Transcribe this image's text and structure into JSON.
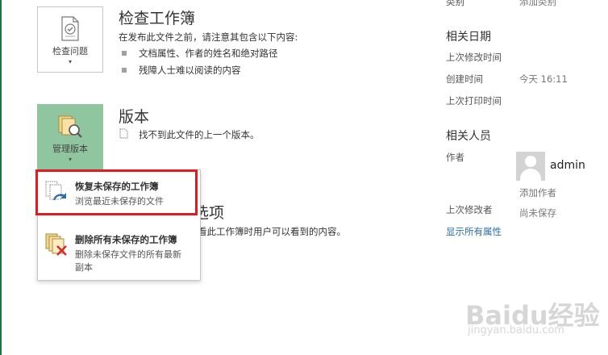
{
  "inspect": {
    "button_label": "检查问题",
    "title": "检查工作簿",
    "desc": "在发布此文件之前，请注意其包含以下内容:",
    "bullets": [
      "文档属性、作者的姓名和绝对路径",
      "残障人士难以阅读的内容"
    ]
  },
  "versions": {
    "button_label": "管理版本",
    "title": "版本",
    "note": "找不到此文件的上一个版本。"
  },
  "hidden_section": {
    "title_tail": "选项",
    "desc_tail": "看此工作簿时用户可以看到的内容。"
  },
  "menu": {
    "items": [
      {
        "title": "恢复未保存的工作簿",
        "desc": "浏览最近未保存的文件"
      },
      {
        "title": "删除所有未保存的工作簿",
        "desc": "删除未保存文件的所有最新副本"
      }
    ]
  },
  "properties": {
    "category_key": "类别",
    "category_value": "添加类别",
    "dates_heading": "相关日期",
    "last_modified_key": "上次修改时间",
    "created_key": "创建时间",
    "created_value": "今天 16:11",
    "last_printed_key": "上次打印时间",
    "people_heading": "相关人员",
    "author_key": "作者",
    "author_name": "admin",
    "add_author": "添加作者",
    "last_modified_by_key": "上次修改者",
    "last_modified_by_value": "尚未保存",
    "show_all": "显示所有属性"
  },
  "watermark": {
    "brand": "Baidu经验",
    "url": "jingyan.baidu.com"
  },
  "colors": {
    "accent_green": "#217346",
    "version_button_bg": "#8fc6a0",
    "highlight_red": "#e11b22",
    "link_blue": "#2b6ea8"
  }
}
